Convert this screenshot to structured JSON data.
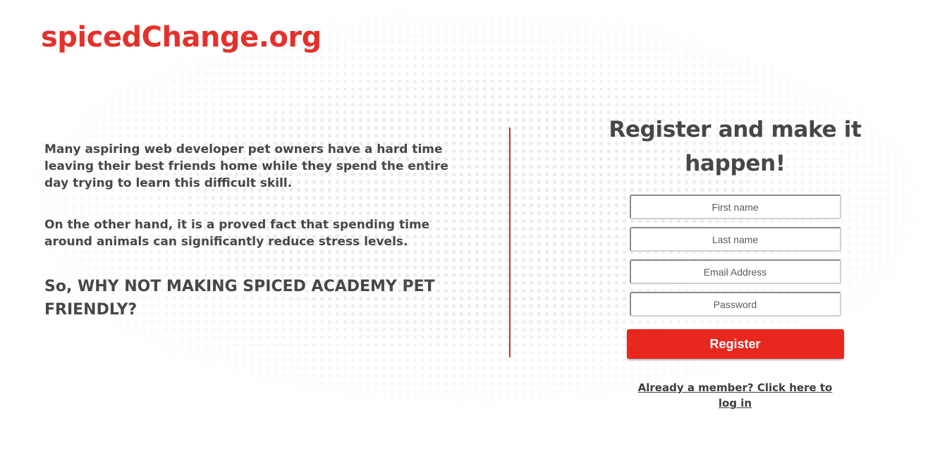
{
  "brand": {
    "logo_text": "spicedChange.org",
    "accent_color": "#e5312b"
  },
  "intro": {
    "paragraph_1": "Many aspiring web developer pet owners have a hard time leaving their best friends home while they spend the entire day trying to learn this difficult skill.",
    "paragraph_2": "On the other hand, it is a proved fact that spending time around animals can significantly reduce stress levels.",
    "headline": "So, WHY NOT MAKING SPICED ACADEMY PET FRIENDLY?"
  },
  "register_form": {
    "title": "Register and make it happen!",
    "first_name_placeholder": "First name",
    "last_name_placeholder": "Last name",
    "email_placeholder": "Email Address",
    "password_placeholder": "Password",
    "submit_label": "Register",
    "login_link_text": "Already a member? Click here to log in"
  }
}
